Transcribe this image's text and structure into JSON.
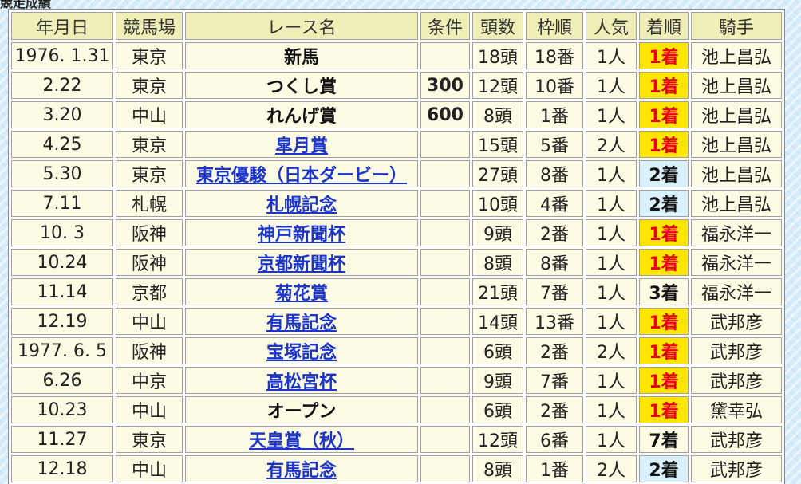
{
  "caption": "競走成績",
  "columns": [
    "年月日",
    "競馬場",
    "レース名",
    "条件",
    "頭数",
    "枠順",
    "人気",
    "着順",
    "騎手"
  ],
  "rows": [
    {
      "date": "1976. 1.31",
      "track": "東京",
      "race": "新馬",
      "link": false,
      "cond": "",
      "heads": "18頭",
      "gate": "18番",
      "pop": "1人",
      "place": "1着",
      "place_class": "p1",
      "jockey": "池上昌弘"
    },
    {
      "date": "2.22",
      "track": "東京",
      "race": "つくし賞",
      "link": false,
      "cond": "300",
      "heads": "12頭",
      "gate": "10番",
      "pop": "1人",
      "place": "1着",
      "place_class": "p1",
      "jockey": "池上昌弘"
    },
    {
      "date": "3.20",
      "track": "中山",
      "race": "れんげ賞",
      "link": false,
      "cond": "600",
      "heads": "8頭",
      "gate": "1番",
      "pop": "1人",
      "place": "1着",
      "place_class": "p1",
      "jockey": "池上昌弘"
    },
    {
      "date": "4.25",
      "track": "東京",
      "race": "皐月賞",
      "link": true,
      "cond": "",
      "heads": "15頭",
      "gate": "5番",
      "pop": "2人",
      "place": "1着",
      "place_class": "p1",
      "jockey": "池上昌弘"
    },
    {
      "date": "5.30",
      "track": "東京",
      "race": "東京優駿（日本ダービー）",
      "link": true,
      "cond": "",
      "heads": "27頭",
      "gate": "8番",
      "pop": "1人",
      "place": "2着",
      "place_class": "p2",
      "jockey": "池上昌弘"
    },
    {
      "date": "7.11",
      "track": "札幌",
      "race": "札幌記念",
      "link": true,
      "cond": "",
      "heads": "10頭",
      "gate": "4番",
      "pop": "1人",
      "place": "2着",
      "place_class": "p2",
      "jockey": "池上昌弘"
    },
    {
      "date": "10. 3",
      "track": "阪神",
      "race": "神戸新聞杯",
      "link": true,
      "cond": "",
      "heads": "9頭",
      "gate": "2番",
      "pop": "1人",
      "place": "1着",
      "place_class": "p1",
      "jockey": "福永洋一"
    },
    {
      "date": "10.24",
      "track": "阪神",
      "race": "京都新聞杯",
      "link": true,
      "cond": "",
      "heads": "8頭",
      "gate": "8番",
      "pop": "1人",
      "place": "1着",
      "place_class": "p1",
      "jockey": "福永洋一"
    },
    {
      "date": "11.14",
      "track": "京都",
      "race": "菊花賞",
      "link": true,
      "cond": "",
      "heads": "21頭",
      "gate": "7番",
      "pop": "1人",
      "place": "3着",
      "place_class": "p3",
      "jockey": "福永洋一"
    },
    {
      "date": "12.19",
      "track": "中山",
      "race": "有馬記念",
      "link": true,
      "cond": "",
      "heads": "14頭",
      "gate": "13番",
      "pop": "1人",
      "place": "1着",
      "place_class": "p1",
      "jockey": "武邦彦"
    },
    {
      "date": "1977. 6. 5",
      "track": "阪神",
      "race": "宝塚記念",
      "link": true,
      "cond": "",
      "heads": "6頭",
      "gate": "2番",
      "pop": "2人",
      "place": "1着",
      "place_class": "p1",
      "jockey": "武邦彦"
    },
    {
      "date": "6.26",
      "track": "中京",
      "race": "高松宮杯",
      "link": true,
      "cond": "",
      "heads": "9頭",
      "gate": "7番",
      "pop": "1人",
      "place": "1着",
      "place_class": "p1",
      "jockey": "武邦彦"
    },
    {
      "date": "10.23",
      "track": "中山",
      "race": "オープン",
      "link": false,
      "cond": "",
      "heads": "6頭",
      "gate": "2番",
      "pop": "1人",
      "place": "1着",
      "place_class": "p1",
      "jockey": "黛幸弘"
    },
    {
      "date": "11.27",
      "track": "東京",
      "race": "天皇賞（秋）",
      "link": true,
      "cond": "",
      "heads": "12頭",
      "gate": "6番",
      "pop": "1人",
      "place": "7着",
      "place_class": "pn",
      "jockey": "武邦彦"
    },
    {
      "date": "12.18",
      "track": "中山",
      "race": "有馬記念",
      "link": true,
      "cond": "",
      "heads": "8頭",
      "gate": "1番",
      "pop": "2人",
      "place": "2着",
      "place_class": "p2",
      "jockey": "武邦彦"
    }
  ],
  "colors": {
    "header_bg": "#efeeb6",
    "cell_bg": "#fdfbe4",
    "win_bg": "#ffe500",
    "win_text": "#e2001a",
    "second_bg": "#d9f1fd",
    "link": "#1b34c9"
  }
}
